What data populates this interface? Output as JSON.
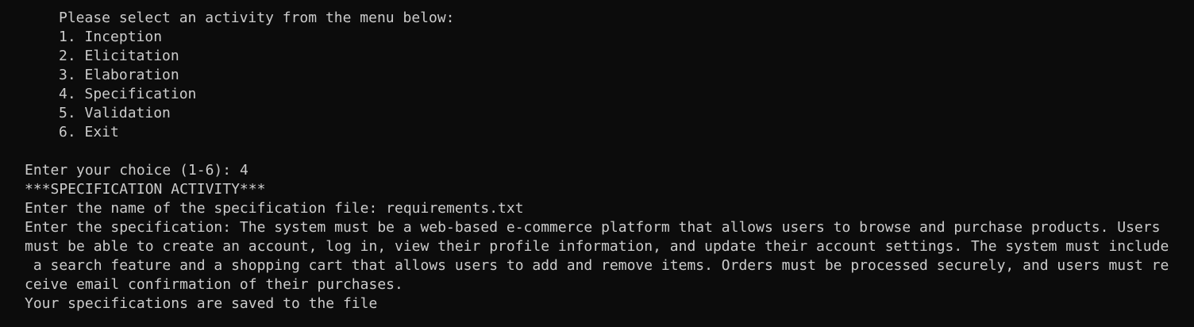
{
  "terminal": {
    "menu_prompt": "Please select an activity from the menu below:",
    "menu_items": [
      "1. Inception",
      "2. Elicitation",
      "3. Elaboration",
      "4. Specification",
      "5. Validation",
      "6. Exit"
    ],
    "choice_prompt": "Enter your choice (1-6): ",
    "choice_value": "4",
    "activity_header": "***SPECIFICATION ACTIVITY***",
    "filename_prompt": "Enter the name of the specification file: ",
    "filename_value": "requirements.txt",
    "spec_lines": [
      "Enter the specification: The system must be a web-based e-commerce platform that allows users to browse and purchase products. Users",
      "must be able to create an account, log in, view their profile information, and update their account settings. The system must include",
      " a search feature and a shopping cart that allows users to add and remove items. Orders must be processed securely, and users must re",
      "ceive email confirmation of their purchases."
    ],
    "saved_message": "Your specifications are saved to the file"
  },
  "colors": {
    "background": "#0c0c0c",
    "foreground": "#cccccc"
  }
}
